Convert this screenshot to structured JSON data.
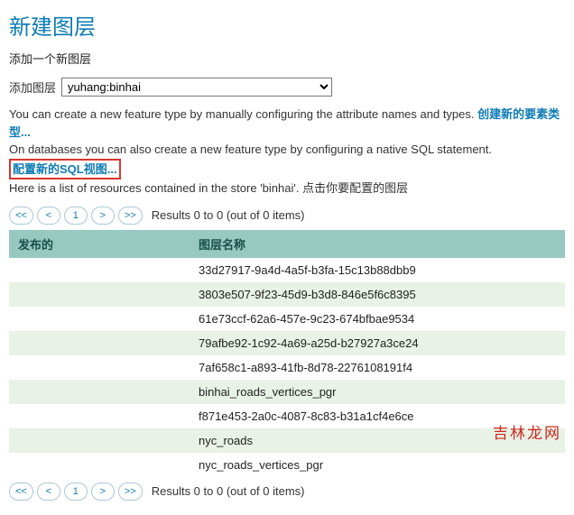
{
  "header": {
    "title": "新建图层",
    "subtitle": "添加一个新图层"
  },
  "add_layer": {
    "label": "添加图层",
    "selected": "yuhang:binhai"
  },
  "info": {
    "line1_a": "You can create a new feature type by manually configuring the attribute names and types. ",
    "link1": "创建新的要素类型...",
    "line2_a": "On databases you can also create a new feature type by configuring a native SQL statement. ",
    "link2": "配置新的SQL视图...",
    "line3": "Here is a list of resources contained in the store 'binhai'. 点击你要配置的图层"
  },
  "pager": {
    "first": "<<",
    "prev": "<",
    "page": "1",
    "next": ">",
    "last": ">>",
    "results": "Results 0 to 0 (out of 0 items)"
  },
  "table": {
    "col_published": "发布的",
    "col_name": "图层名称",
    "rows": [
      {
        "published": "",
        "name": "33d27917-9a4d-4a5f-b3fa-15c13b88dbb9"
      },
      {
        "published": "",
        "name": "3803e507-9f23-45d9-b3d8-846e5f6c8395"
      },
      {
        "published": "",
        "name": "61e73ccf-62a6-457e-9c23-674bfbae9534"
      },
      {
        "published": "",
        "name": "79afbe92-1c92-4a69-a25d-b27927a3ce24"
      },
      {
        "published": "",
        "name": "7af658c1-a893-41fb-8d78-2276108191f4"
      },
      {
        "published": "",
        "name": "binhai_roads_vertices_pgr"
      },
      {
        "published": "",
        "name": "f871e453-2a0c-4087-8c83-b31a1cf4e6ce"
      },
      {
        "published": "",
        "name": "nyc_roads"
      },
      {
        "published": "",
        "name": "nyc_roads_vertices_pgr"
      }
    ]
  },
  "watermark": "吉林龙网"
}
